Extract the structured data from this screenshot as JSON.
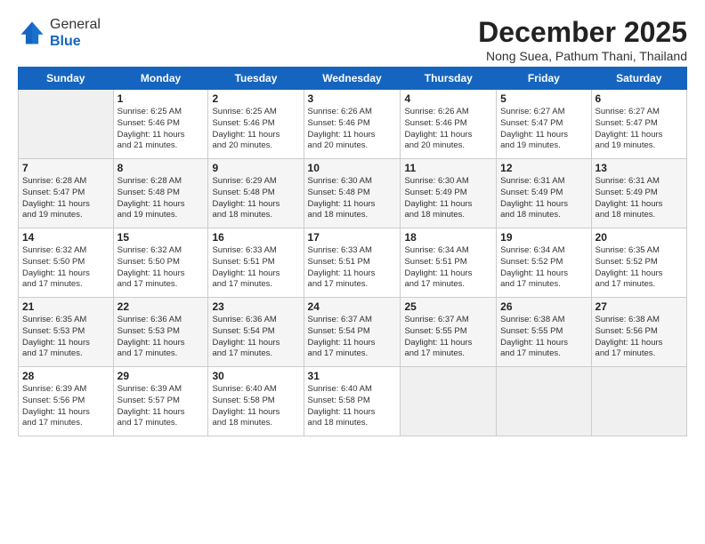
{
  "logo": {
    "line1": "General",
    "line2": "Blue"
  },
  "title": "December 2025",
  "subtitle": "Nong Suea, Pathum Thani, Thailand",
  "days_of_week": [
    "Sunday",
    "Monday",
    "Tuesday",
    "Wednesday",
    "Thursday",
    "Friday",
    "Saturday"
  ],
  "weeks": [
    [
      {
        "day": "",
        "info": ""
      },
      {
        "day": "1",
        "info": "Sunrise: 6:25 AM\nSunset: 5:46 PM\nDaylight: 11 hours\nand 21 minutes."
      },
      {
        "day": "2",
        "info": "Sunrise: 6:25 AM\nSunset: 5:46 PM\nDaylight: 11 hours\nand 20 minutes."
      },
      {
        "day": "3",
        "info": "Sunrise: 6:26 AM\nSunset: 5:46 PM\nDaylight: 11 hours\nand 20 minutes."
      },
      {
        "day": "4",
        "info": "Sunrise: 6:26 AM\nSunset: 5:46 PM\nDaylight: 11 hours\nand 20 minutes."
      },
      {
        "day": "5",
        "info": "Sunrise: 6:27 AM\nSunset: 5:47 PM\nDaylight: 11 hours\nand 19 minutes."
      },
      {
        "day": "6",
        "info": "Sunrise: 6:27 AM\nSunset: 5:47 PM\nDaylight: 11 hours\nand 19 minutes."
      }
    ],
    [
      {
        "day": "7",
        "info": "Sunrise: 6:28 AM\nSunset: 5:47 PM\nDaylight: 11 hours\nand 19 minutes."
      },
      {
        "day": "8",
        "info": "Sunrise: 6:28 AM\nSunset: 5:48 PM\nDaylight: 11 hours\nand 19 minutes."
      },
      {
        "day": "9",
        "info": "Sunrise: 6:29 AM\nSunset: 5:48 PM\nDaylight: 11 hours\nand 18 minutes."
      },
      {
        "day": "10",
        "info": "Sunrise: 6:30 AM\nSunset: 5:48 PM\nDaylight: 11 hours\nand 18 minutes."
      },
      {
        "day": "11",
        "info": "Sunrise: 6:30 AM\nSunset: 5:49 PM\nDaylight: 11 hours\nand 18 minutes."
      },
      {
        "day": "12",
        "info": "Sunrise: 6:31 AM\nSunset: 5:49 PM\nDaylight: 11 hours\nand 18 minutes."
      },
      {
        "day": "13",
        "info": "Sunrise: 6:31 AM\nSunset: 5:49 PM\nDaylight: 11 hours\nand 18 minutes."
      }
    ],
    [
      {
        "day": "14",
        "info": "Sunrise: 6:32 AM\nSunset: 5:50 PM\nDaylight: 11 hours\nand 17 minutes."
      },
      {
        "day": "15",
        "info": "Sunrise: 6:32 AM\nSunset: 5:50 PM\nDaylight: 11 hours\nand 17 minutes."
      },
      {
        "day": "16",
        "info": "Sunrise: 6:33 AM\nSunset: 5:51 PM\nDaylight: 11 hours\nand 17 minutes."
      },
      {
        "day": "17",
        "info": "Sunrise: 6:33 AM\nSunset: 5:51 PM\nDaylight: 11 hours\nand 17 minutes."
      },
      {
        "day": "18",
        "info": "Sunrise: 6:34 AM\nSunset: 5:51 PM\nDaylight: 11 hours\nand 17 minutes."
      },
      {
        "day": "19",
        "info": "Sunrise: 6:34 AM\nSunset: 5:52 PM\nDaylight: 11 hours\nand 17 minutes."
      },
      {
        "day": "20",
        "info": "Sunrise: 6:35 AM\nSunset: 5:52 PM\nDaylight: 11 hours\nand 17 minutes."
      }
    ],
    [
      {
        "day": "21",
        "info": "Sunrise: 6:35 AM\nSunset: 5:53 PM\nDaylight: 11 hours\nand 17 minutes."
      },
      {
        "day": "22",
        "info": "Sunrise: 6:36 AM\nSunset: 5:53 PM\nDaylight: 11 hours\nand 17 minutes."
      },
      {
        "day": "23",
        "info": "Sunrise: 6:36 AM\nSunset: 5:54 PM\nDaylight: 11 hours\nand 17 minutes."
      },
      {
        "day": "24",
        "info": "Sunrise: 6:37 AM\nSunset: 5:54 PM\nDaylight: 11 hours\nand 17 minutes."
      },
      {
        "day": "25",
        "info": "Sunrise: 6:37 AM\nSunset: 5:55 PM\nDaylight: 11 hours\nand 17 minutes."
      },
      {
        "day": "26",
        "info": "Sunrise: 6:38 AM\nSunset: 5:55 PM\nDaylight: 11 hours\nand 17 minutes."
      },
      {
        "day": "27",
        "info": "Sunrise: 6:38 AM\nSunset: 5:56 PM\nDaylight: 11 hours\nand 17 minutes."
      }
    ],
    [
      {
        "day": "28",
        "info": "Sunrise: 6:39 AM\nSunset: 5:56 PM\nDaylight: 11 hours\nand 17 minutes."
      },
      {
        "day": "29",
        "info": "Sunrise: 6:39 AM\nSunset: 5:57 PM\nDaylight: 11 hours\nand 17 minutes."
      },
      {
        "day": "30",
        "info": "Sunrise: 6:40 AM\nSunset: 5:58 PM\nDaylight: 11 hours\nand 18 minutes."
      },
      {
        "day": "31",
        "info": "Sunrise: 6:40 AM\nSunset: 5:58 PM\nDaylight: 11 hours\nand 18 minutes."
      },
      {
        "day": "",
        "info": ""
      },
      {
        "day": "",
        "info": ""
      },
      {
        "day": "",
        "info": ""
      }
    ]
  ]
}
